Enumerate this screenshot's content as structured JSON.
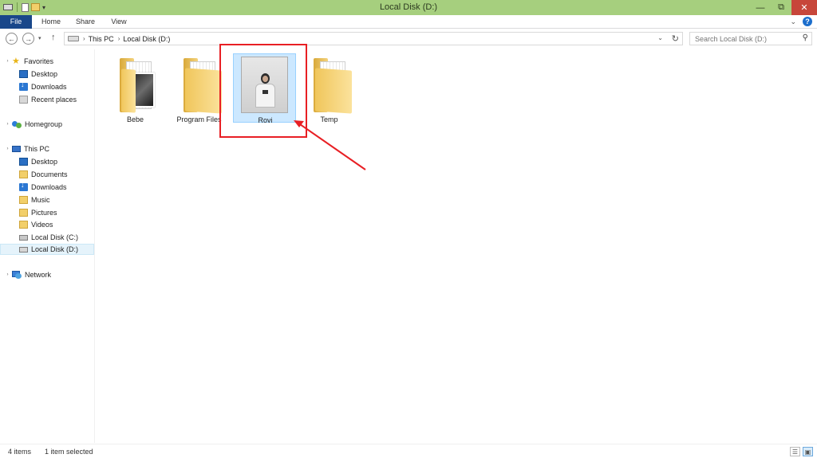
{
  "window": {
    "title": "Local Disk (D:)",
    "controls": {
      "minimize": "—",
      "restore": "⧉",
      "close": "✕"
    }
  },
  "ribbon": {
    "tabs": [
      "File",
      "Home",
      "Share",
      "View"
    ],
    "help": "?",
    "collapse": "⌄"
  },
  "nav": {
    "back": "←",
    "forward": "→",
    "recent": "▾",
    "up": "↑",
    "breadcrumb": [
      "This PC",
      "Local Disk (D:)"
    ],
    "breadcrumb_sep": "›",
    "dropdown": "⌄",
    "refresh": "↻",
    "search_placeholder": "Search Local Disk (D:)",
    "search_icon": "⚲"
  },
  "sidebar": {
    "favorites": {
      "label": "Favorites",
      "items": [
        "Desktop",
        "Downloads",
        "Recent places"
      ]
    },
    "homegroup": {
      "label": "Homegroup"
    },
    "thispc": {
      "label": "This PC",
      "items": [
        "Desktop",
        "Documents",
        "Downloads",
        "Music",
        "Pictures",
        "Videos",
        "Local Disk (C:)",
        "Local Disk (D:)"
      ]
    },
    "network": {
      "label": "Network"
    }
  },
  "content": {
    "items": [
      {
        "name": "Bebe",
        "icon": "folder-with-photo-icon"
      },
      {
        "name": "Program Files",
        "icon": "folder-icon"
      },
      {
        "name": "Rovi",
        "icon": "photo-thumbnail-icon",
        "selected": true
      },
      {
        "name": "Temp",
        "icon": "folder-icon"
      }
    ]
  },
  "status": {
    "count": "4 items",
    "selection": "1 item selected"
  },
  "colors": {
    "titlebar": "#a6cf7e",
    "file_tab": "#19478a",
    "selection": "#cce8ff",
    "annotation": "#e81f24"
  }
}
